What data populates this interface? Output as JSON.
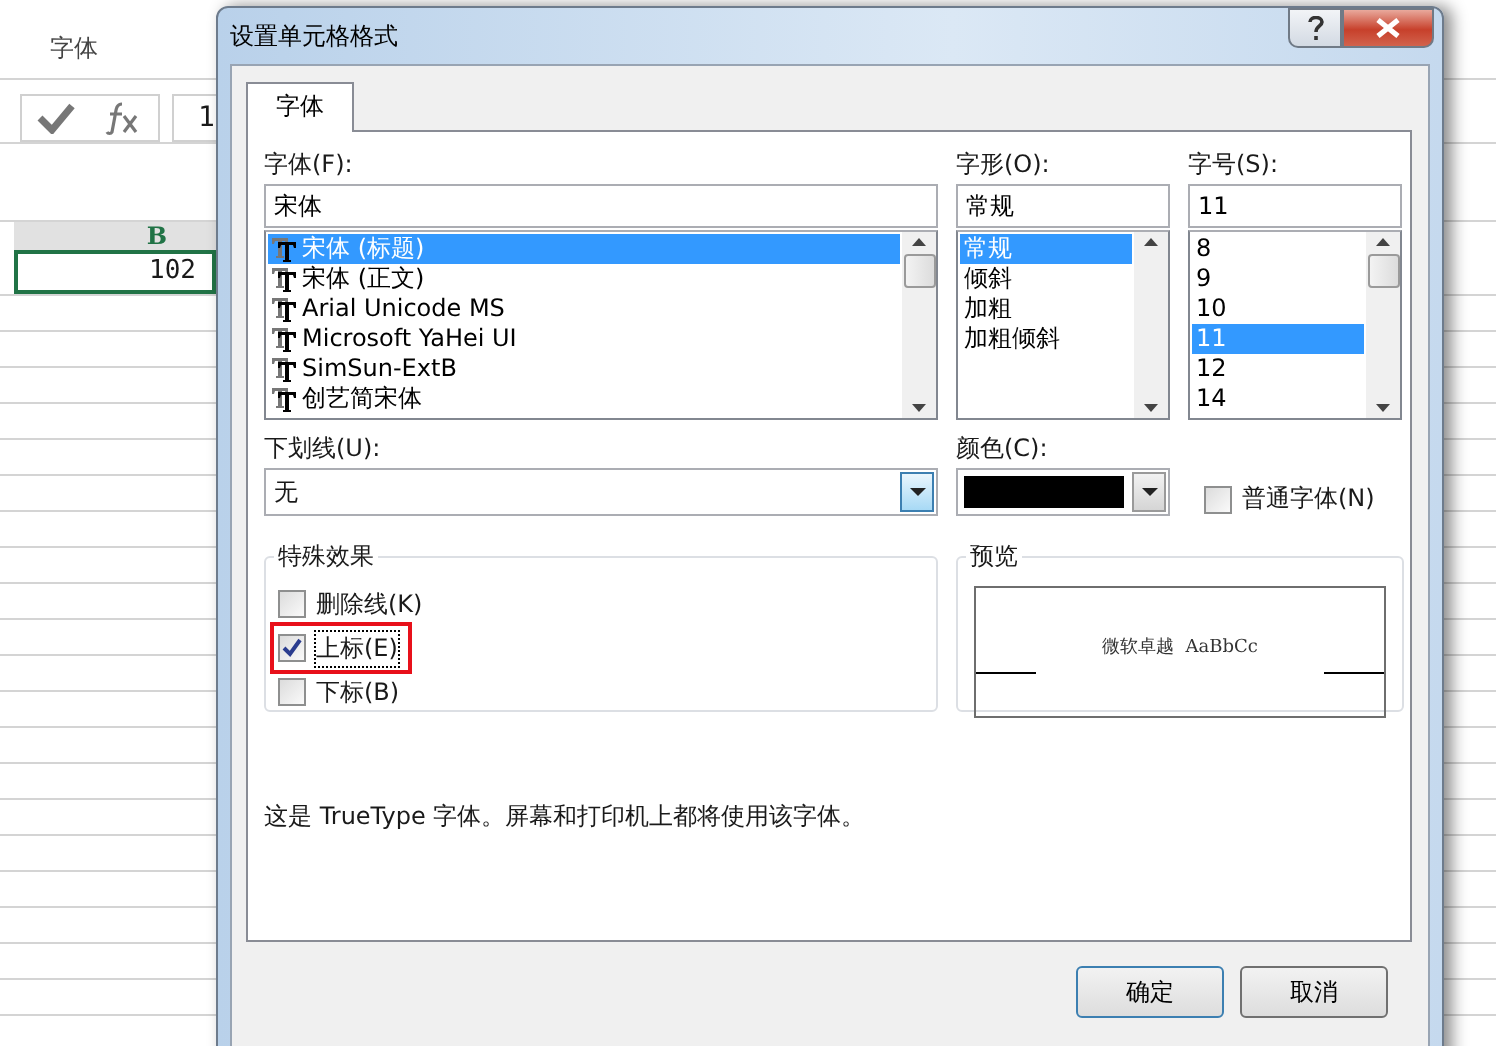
{
  "excel": {
    "ribbon_group": "字体",
    "formula_bar": {
      "value": "1"
    },
    "column_header": "B",
    "cell": "102"
  },
  "dialog": {
    "title": "设置单元格格式",
    "tabs": [
      {
        "label": "字体",
        "selected": true
      }
    ],
    "font": {
      "label": "字体(F):",
      "value": "宋体",
      "items": [
        {
          "label": "宋体 (标题)",
          "selected": true
        },
        {
          "label": "宋体 (正文)",
          "selected": false
        },
        {
          "label": "Arial Unicode MS",
          "selected": false
        },
        {
          "label": "Microsoft YaHei UI",
          "selected": false
        },
        {
          "label": "SimSun-ExtB",
          "selected": false
        },
        {
          "label": "创艺简宋体",
          "selected": false
        }
      ]
    },
    "style": {
      "label": "字形(O):",
      "value": "常规",
      "items": [
        {
          "label": "常规",
          "selected": true
        },
        {
          "label": "倾斜",
          "selected": false
        },
        {
          "label": "加粗",
          "selected": false
        },
        {
          "label": "加粗倾斜",
          "selected": false
        }
      ]
    },
    "size": {
      "label": "字号(S):",
      "value": "11",
      "items": [
        {
          "label": "8",
          "selected": false
        },
        {
          "label": "9",
          "selected": false
        },
        {
          "label": "10",
          "selected": false
        },
        {
          "label": "11",
          "selected": true
        },
        {
          "label": "12",
          "selected": false
        },
        {
          "label": "14",
          "selected": false
        }
      ]
    },
    "underline": {
      "label": "下划线(U):",
      "value": "无"
    },
    "color": {
      "label": "颜色(C):",
      "color": "#000000"
    },
    "normal_font": {
      "label": "普通字体(N)",
      "checked": false
    },
    "effects": {
      "title": "特殊效果",
      "items": [
        {
          "label": "删除线(K)",
          "checked": false,
          "highlighted": false
        },
        {
          "label": "上标(E)",
          "checked": true,
          "highlighted": true
        },
        {
          "label": "下标(B)",
          "checked": false,
          "highlighted": false
        }
      ]
    },
    "preview": {
      "title": "预览",
      "sample": "微软卓越  AaBbCc"
    },
    "note": "这是 TrueType 字体。屏幕和打印机上都将使用该字体。",
    "buttons": [
      "确定",
      "取消"
    ]
  }
}
